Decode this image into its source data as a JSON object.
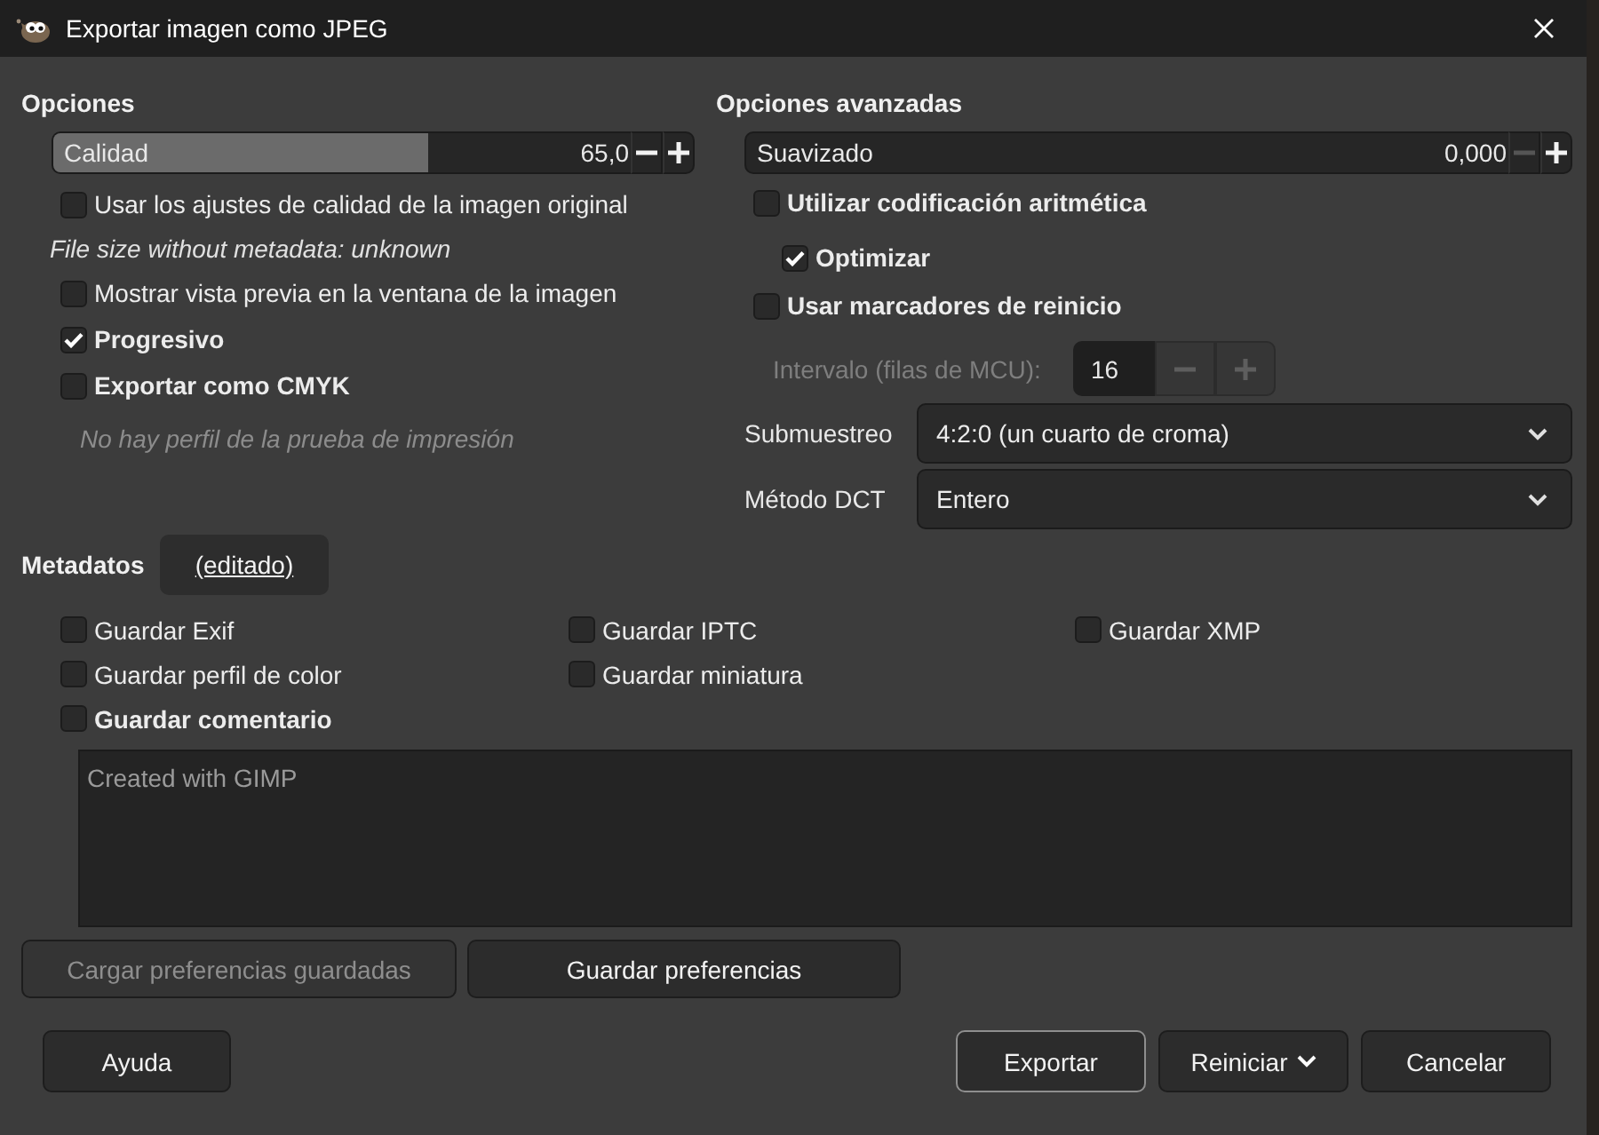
{
  "window": {
    "title": "Exportar imagen como JPEG"
  },
  "options": {
    "heading": "Opciones",
    "quality": {
      "label": "Calidad",
      "value": "65,0",
      "level": 0.65,
      "decrease_disabled": false
    },
    "items": [
      {
        "kind": "checkbox",
        "label": "Usar los ajustes de calidad de la imagen original",
        "checked": false,
        "bold": false
      },
      {
        "kind": "note",
        "text": "File size without metadata: unknown"
      },
      {
        "kind": "checkbox",
        "label": "Mostrar vista previa en la ventana de la imagen",
        "checked": false,
        "bold": false
      },
      {
        "kind": "checkbox",
        "label": "Progresivo",
        "checked": true,
        "bold": true
      },
      {
        "kind": "checkbox",
        "label": "Exportar como CMYK",
        "checked": false,
        "bold": true
      },
      {
        "kind": "hint",
        "text": "No hay perfil de la prueba de impresión"
      }
    ]
  },
  "advanced": {
    "heading": "Opciones avanzadas",
    "smoothing": {
      "label": "Suavizado",
      "value": "0,000",
      "decrease_disabled": true
    },
    "checks": [
      {
        "label": "Utilizar codificación aritmética",
        "checked": false,
        "bold": true,
        "children": [
          {
            "label": "Optimizar",
            "checked": true,
            "bold": true
          }
        ]
      },
      {
        "label": "Usar marcadores de reinicio",
        "checked": false,
        "bold": true
      }
    ],
    "restart_interval": {
      "label": "Intervalo (filas de MCU):",
      "value": "16",
      "disabled": true
    },
    "selects": [
      {
        "label": "Submuestreo",
        "value": "4:2:0 (un cuarto de croma)"
      },
      {
        "label": "Método DCT",
        "value": "Entero"
      }
    ]
  },
  "metadata": {
    "heading": "Metadatos",
    "edited_button": "(editado)",
    "rows": [
      [
        {
          "label": "Guardar Exif",
          "checked": false,
          "bold": false
        },
        {
          "label": "Guardar IPTC",
          "checked": false,
          "bold": false
        },
        {
          "label": "Guardar XMP",
          "checked": false,
          "bold": false
        }
      ],
      [
        {
          "label": "Guardar perfil de color",
          "checked": false,
          "bold": false
        },
        {
          "label": "Guardar miniatura",
          "checked": false,
          "bold": false
        }
      ],
      [
        {
          "label": "Guardar comentario",
          "checked": false,
          "bold": true
        }
      ]
    ],
    "comment": {
      "value": "Created with GIMP",
      "disabled": true
    }
  },
  "preference_buttons": [
    {
      "label": "Cargar preferencias guardadas",
      "disabled": true
    },
    {
      "label": "Guardar preferencias",
      "disabled": false
    }
  ],
  "help_button": {
    "label": "Ayuda"
  },
  "action_buttons": [
    {
      "label": "Exportar",
      "default": true,
      "menu": false
    },
    {
      "label": "Reiniciar",
      "default": false,
      "menu": true
    },
    {
      "label": "Cancelar",
      "default": false,
      "menu": false
    }
  ]
}
